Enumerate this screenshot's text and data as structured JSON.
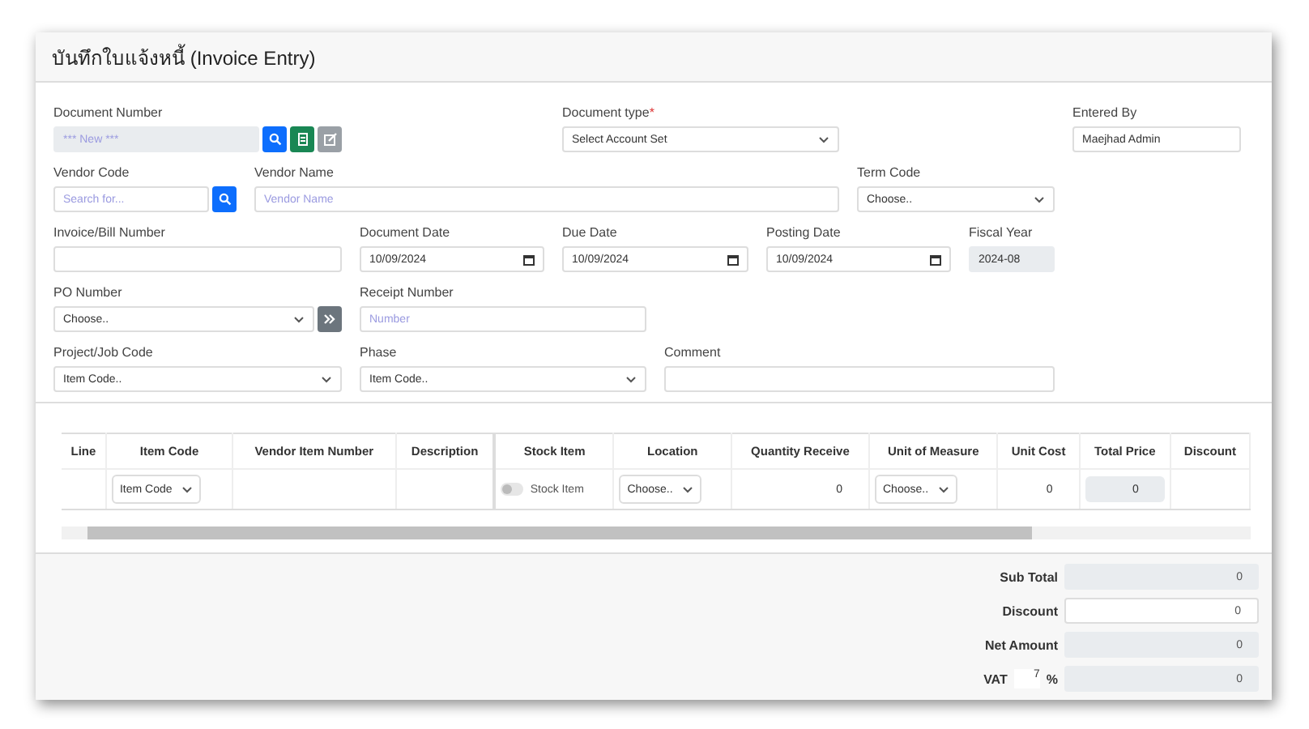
{
  "window": {
    "title": "บันทึกใบแจ้งหนี้ (Invoice Entry)"
  },
  "form_rows": [
    [
      {
        "kind": "doc-number",
        "label": "Document Number",
        "placeholder": "*** New ***"
      },
      {
        "kind": "select",
        "label": "Document type",
        "required_mark": "*",
        "value": "Select Account Set"
      },
      {
        "kind": "input",
        "label": "Entered By",
        "value": "Maejhad Admin",
        "readonly": false
      }
    ],
    [
      {
        "kind": "search",
        "label": "Vendor Code",
        "placeholder": "Search for..."
      },
      {
        "kind": "input",
        "label": "Vendor Name",
        "placeholder": "Vendor Name",
        "readonly": false
      },
      {
        "kind": "select",
        "label": "Term Code",
        "value": "Choose.."
      }
    ],
    [
      {
        "kind": "input",
        "label": "Invoice/Bill Number",
        "readonly": false
      },
      {
        "kind": "date",
        "label": "Document Date",
        "value": "10/09/2024"
      },
      {
        "kind": "date",
        "label": "Due Date",
        "value": "10/09/2024"
      },
      {
        "kind": "date",
        "label": "Posting Date",
        "value": "10/09/2024"
      },
      {
        "kind": "input",
        "label": "Fiscal Year",
        "value": "2024-08",
        "readonly": true
      }
    ],
    [
      {
        "kind": "select-button",
        "label": "PO Number",
        "value": "Choose.."
      },
      {
        "kind": "input",
        "label": "Receipt Number",
        "placeholder": "Number",
        "readonly": false
      }
    ],
    [
      {
        "kind": "select",
        "label": "Project/Job Code",
        "value": "Item Code.."
      },
      {
        "kind": "select",
        "label": "Phase",
        "value": "Item Code.."
      },
      {
        "kind": "input",
        "label": "Comment",
        "readonly": false
      }
    ]
  ],
  "table": {
    "columns": [
      "Line",
      "Item Code",
      "Vendor Item Number",
      "Description",
      "Stock Item",
      "Location",
      "Quantity Receive",
      "Unit of Measure",
      "Unit Cost",
      "Total Price",
      "Discount"
    ],
    "rows": [
      [
        {
          "kind": "text"
        },
        {
          "kind": "select",
          "value": "Item Code"
        },
        {
          "kind": "text"
        },
        {
          "kind": "text"
        },
        {
          "kind": "toggle",
          "label": "Stock Item",
          "on": false
        },
        {
          "kind": "select",
          "value": "Choose.."
        },
        {
          "kind": "number",
          "value": "0"
        },
        {
          "kind": "select",
          "value": "Choose.."
        },
        {
          "kind": "number",
          "value": "0"
        },
        {
          "kind": "readonly",
          "value": "0"
        },
        {
          "kind": "text"
        }
      ]
    ]
  },
  "totals": [
    {
      "label": "Sub Total",
      "value": "0",
      "editable": false
    },
    {
      "label": "Discount",
      "value": "0",
      "editable": true
    },
    {
      "label": "Net Amount",
      "value": "0",
      "editable": false
    },
    {
      "label": "VAT",
      "rate": "7",
      "unit": "%",
      "value": "0",
      "editable": false
    }
  ]
}
